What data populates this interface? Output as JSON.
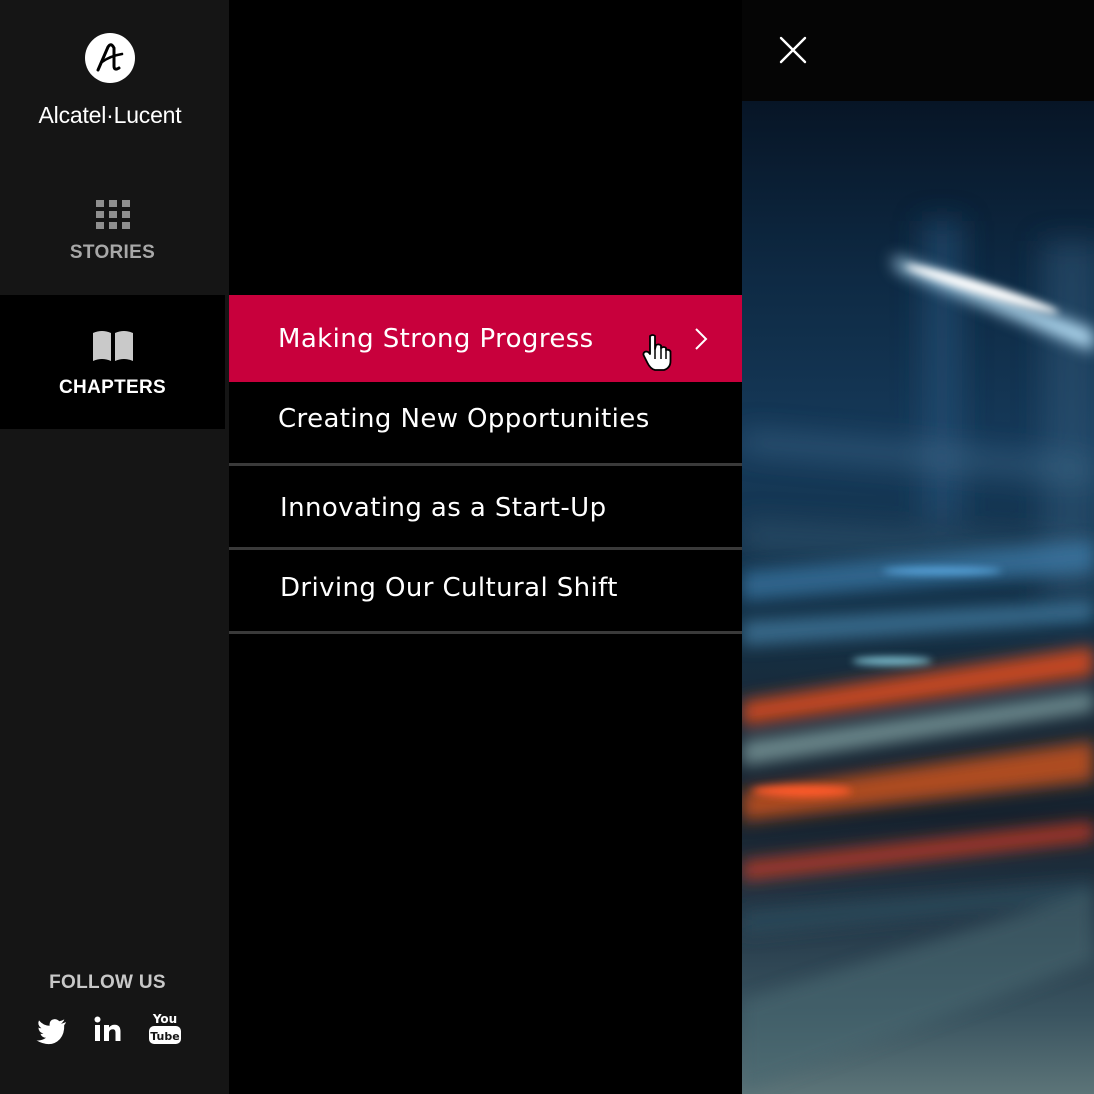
{
  "brand": {
    "name": "Alcatel·Lucent"
  },
  "sidebar": {
    "nav": [
      {
        "label": "STORIES",
        "icon": "grid-icon",
        "active": false
      },
      {
        "label": "CHAPTERS",
        "icon": "open-book-icon",
        "active": true
      }
    ],
    "follow_label": "FOLLOW US",
    "social": [
      {
        "name": "twitter-icon"
      },
      {
        "name": "linkedin-icon"
      },
      {
        "name": "youtube-icon"
      }
    ]
  },
  "chapters": [
    {
      "label": "Making Strong Progress",
      "active": true
    },
    {
      "label": "Creating New Opportunities",
      "active": false
    },
    {
      "label": "Innovating as a Start-Up",
      "active": false
    },
    {
      "label": "Driving Our Cultural Shift",
      "active": false
    }
  ],
  "colors": {
    "accent": "#c8003c",
    "sidebar": "#151515",
    "menu": "#000000"
  }
}
